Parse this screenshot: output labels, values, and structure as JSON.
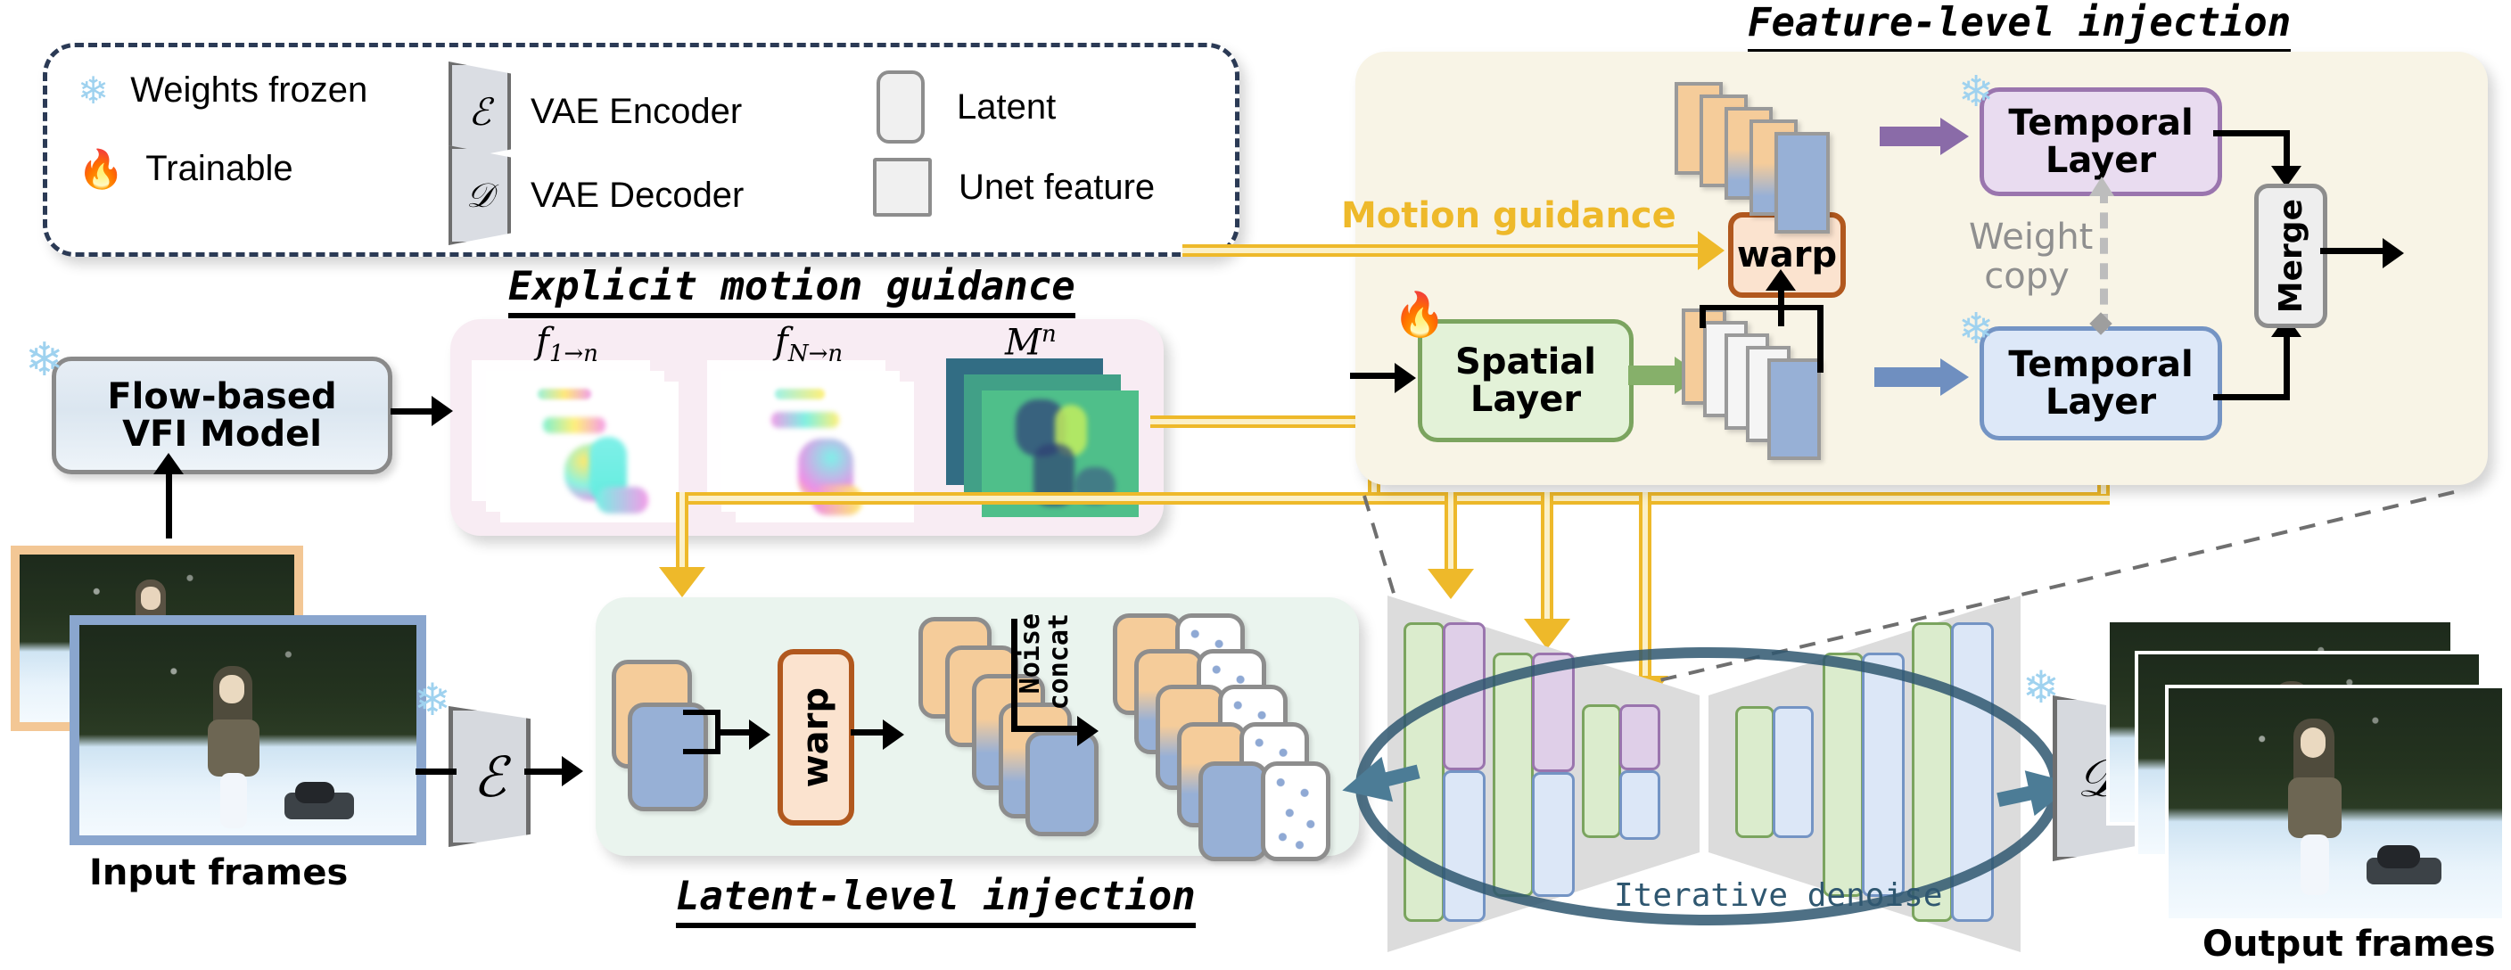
{
  "legend": {
    "items": [
      {
        "icon": "snowflake-icon",
        "glyph": "❄",
        "label": "Weights frozen"
      },
      {
        "icon": "fire-icon",
        "glyph": "🔥",
        "label": "Trainable"
      },
      {
        "icon": "vae-encoder-icon",
        "glyph": "ℰ",
        "label": "VAE Encoder"
      },
      {
        "icon": "vae-decoder-icon",
        "glyph": "𝒟",
        "label": "VAE Decoder"
      },
      {
        "icon": "latent-swatch",
        "glyph": "",
        "label": "Latent"
      },
      {
        "icon": "unet-feature-swatch",
        "glyph": "",
        "label": "Unet feature"
      }
    ]
  },
  "pipeline": {
    "vfi_model_label": "Flow-based\nVFI Model",
    "input_frames_label": "Input frames",
    "output_frames_label": "Output frames",
    "vae_encoder_symbol": "ℰ",
    "vae_decoder_symbol": "𝒟",
    "iterative_denoise_label": "Iterative denoise"
  },
  "explicit_motion": {
    "title": "Explicit motion guidance",
    "stack_labels": [
      "f",
      "f",
      "M"
    ],
    "label_flow_1": "f",
    "label_flow_1_sub": "1→n",
    "label_flow_N": "f",
    "label_flow_N_sub": "N→n",
    "label_mask": "M",
    "label_mask_sup": "n"
  },
  "latent_injection": {
    "title": "Latent-level injection",
    "warp_label": "warp",
    "noise_concat_label_line1": "Noise",
    "noise_concat_label_line2": "concat"
  },
  "feature_injection": {
    "title": "Feature-level injection",
    "motion_guidance_label": "Motion guidance",
    "warp_label": "warp",
    "spatial_layer_label": "Spatial\nLayer",
    "temporal_layer_top_label": "Temporal\nLayer",
    "temporal_layer_bottom_label": "Temporal\nLayer",
    "weight_copy_label_line1": "Weight",
    "weight_copy_label_line2": "copy",
    "merge_label": "Merge"
  },
  "colors": {
    "legend_border": "#2b3a55",
    "motion_panel_bg": "#f8ecf3",
    "latent_panel_bg": "#eaf4ee",
    "feature_panel_bg": "#f8f4e6",
    "motion_yellow": "#eeb92a",
    "warp_border": "#b1581e",
    "warp_fill": "#fbe3cf",
    "spatial_border": "#7ba45f",
    "spatial_fill": "#e3f2d8",
    "temporal_top_border": "#9a75ae",
    "temporal_top_fill": "#e9dcf0",
    "temporal_bottom_border": "#7494c4",
    "temporal_bottom_fill": "#dde8f8",
    "merge_fill": "#eeeeee",
    "denoise_text": "#2f5770",
    "latent_orange": "#f5cc9a",
    "latent_blue": "#97b0d6"
  }
}
